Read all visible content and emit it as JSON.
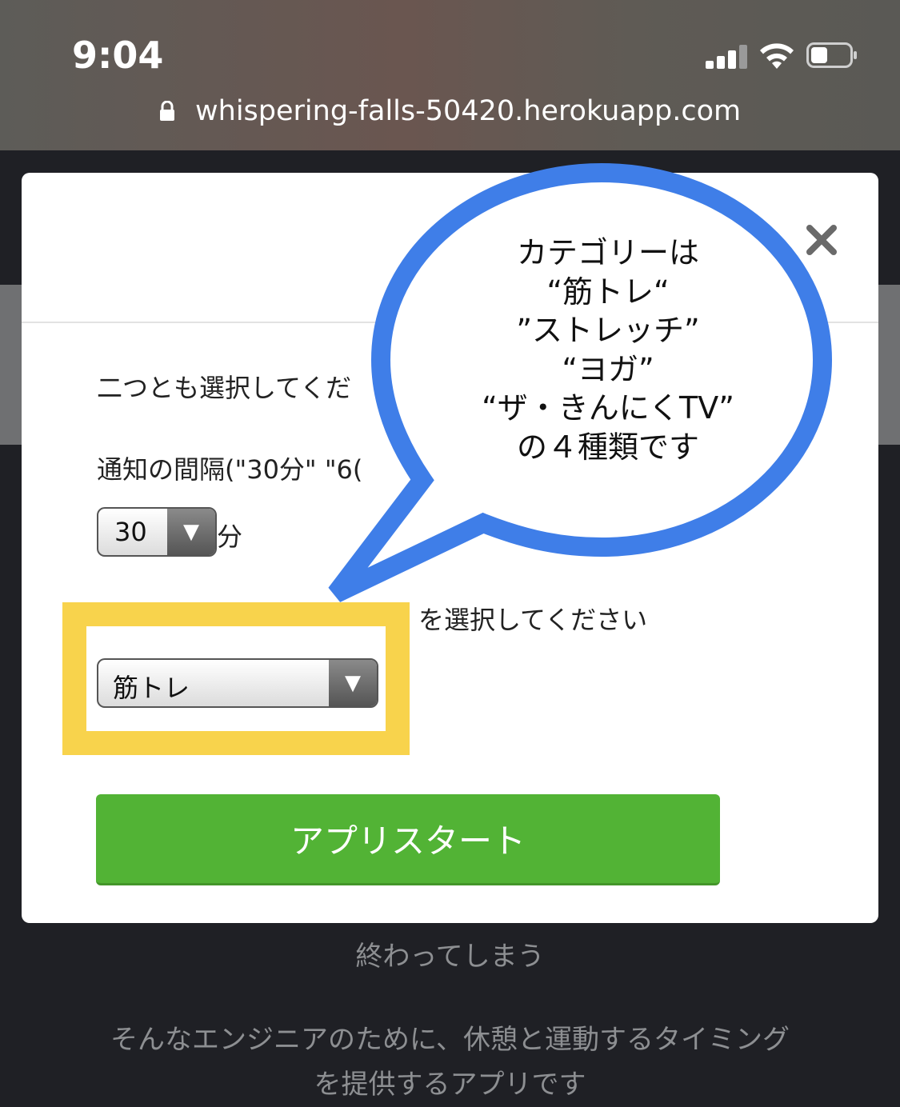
{
  "status_bar": {
    "time": "9:04"
  },
  "browser": {
    "url": "whispering-falls-50420.herokuapp.com"
  },
  "modal": {
    "instruction": "二つとも選択してくだ",
    "interval_label": "通知の間隔(\"30分\" \"6(",
    "interval_value": "30",
    "interval_unit": "分",
    "category_label_tail": "を選択してください",
    "category_value": "筋トレ",
    "start_button": "アプリスタート"
  },
  "callout": {
    "lines": [
      "カテゴリーは",
      "“筋トレ“",
      "”ストレッチ”",
      "“ヨガ”",
      "“ザ・きんにくTV”",
      "の４種類です"
    ]
  },
  "background_page": {
    "line1": "終わってしまう",
    "line2": "そんなエンジニアのために、休憩と運動するタイミング",
    "line3": "を提供するアプリです"
  },
  "colors": {
    "start_button": "#52b335",
    "highlight": "#f8d34c",
    "callout_outline": "#3f7ee8"
  }
}
